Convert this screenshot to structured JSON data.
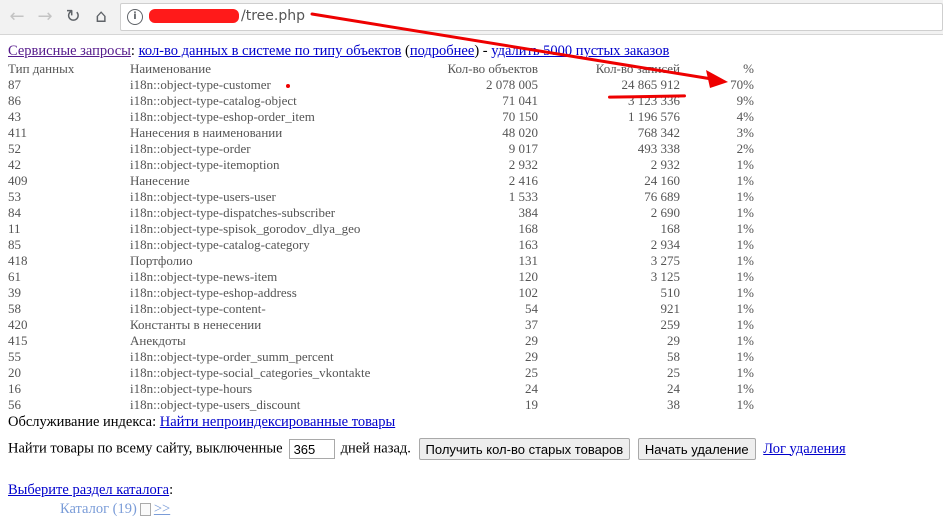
{
  "browser": {
    "url_visible": "/tree.php"
  },
  "header": {
    "service_label": "Сервисные запросы",
    "colon": ":",
    "link_counts": "кол-во данных в системе по типу объектов",
    "paren_open": "(",
    "link_details": "подробнее",
    "paren_close": ")",
    "dash": " - ",
    "link_delete": "удалить 5000 пустых заказов"
  },
  "table": {
    "headers": [
      "Тип данных",
      "Наименование",
      "Кол-во объектов",
      "Кол-во записей",
      "%"
    ],
    "rows": [
      [
        "87",
        "i18n::object-type-customer",
        "2 078 005",
        "24 865 912",
        "70%"
      ],
      [
        "86",
        "i18n::object-type-catalog-object",
        "71 041",
        "3 123 336",
        "9%"
      ],
      [
        "43",
        "i18n::object-type-eshop-order_item",
        "70 150",
        "1 196 576",
        "4%"
      ],
      [
        "411",
        "Нанесения в наименовании",
        "48 020",
        "768 342",
        "3%"
      ],
      [
        "52",
        "i18n::object-type-order",
        "9 017",
        "493 338",
        "2%"
      ],
      [
        "42",
        "i18n::object-type-itemoption",
        "2 932",
        "2 932",
        "1%"
      ],
      [
        "409",
        "Нанесение",
        "2 416",
        "24 160",
        "1%"
      ],
      [
        "53",
        "i18n::object-type-users-user",
        "1 533",
        "76 689",
        "1%"
      ],
      [
        "84",
        "i18n::object-type-dispatches-subscriber",
        "384",
        "2 690",
        "1%"
      ],
      [
        "11",
        "i18n::object-type-spisok_gorodov_dlya_geo",
        "168",
        "168",
        "1%"
      ],
      [
        "85",
        "i18n::object-type-catalog-category",
        "163",
        "2 934",
        "1%"
      ],
      [
        "418",
        "Портфолио",
        "131",
        "3 275",
        "1%"
      ],
      [
        "61",
        "i18n::object-type-news-item",
        "120",
        "3 125",
        "1%"
      ],
      [
        "39",
        "i18n::object-type-eshop-address",
        "102",
        "510",
        "1%"
      ],
      [
        "58",
        "i18n::object-type-content-",
        "54",
        "921",
        "1%"
      ],
      [
        "420",
        "Константы в ненесении",
        "37",
        "259",
        "1%"
      ],
      [
        "415",
        "Анекдоты",
        "29",
        "29",
        "1%"
      ],
      [
        "55",
        "i18n::object-type-order_summ_percent",
        "29",
        "58",
        "1%"
      ],
      [
        "20",
        "i18n::object-type-social_categories_vkontakte",
        "25",
        "25",
        "1%"
      ],
      [
        "16",
        "i18n::object-type-hours",
        "24",
        "24",
        "1%"
      ],
      [
        "56",
        "i18n::object-type-users_discount",
        "19",
        "38",
        "1%"
      ]
    ]
  },
  "maintenance": {
    "label": "Обслуживание индекса:",
    "link": "Найти непроиндексированные товары"
  },
  "find": {
    "label": "Найти товары по всему сайту, выключенные",
    "days_value": "365",
    "days_suffix": "дней назад.",
    "btn_count": "Получить кол-во старых товаров",
    "btn_delete": "Начать удаление",
    "log_link": "Лог удаления"
  },
  "catalog_section": {
    "link": "Выберите раздел каталога",
    "colon": ":",
    "item_label": "Каталог (19)",
    "item_more": ">>"
  },
  "colors": {
    "annotation_red": "#e00000",
    "link_blue": "#0000cc"
  }
}
